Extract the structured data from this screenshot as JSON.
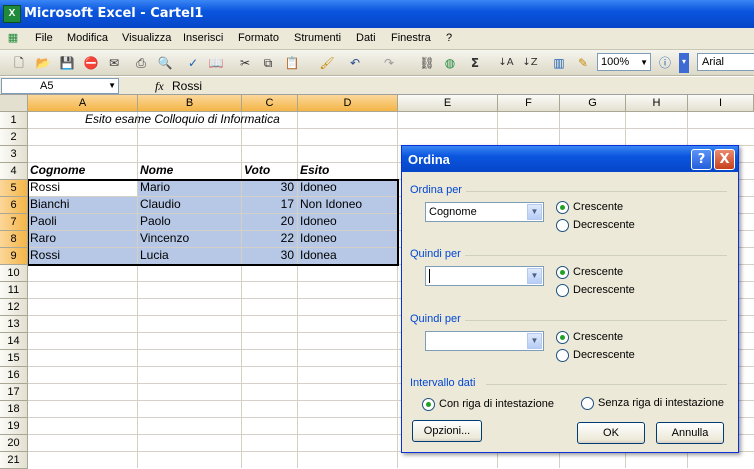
{
  "window": {
    "title": "Microsoft Excel - Cartel1",
    "app_icon": "X"
  },
  "menu": [
    "File",
    "Modifica",
    "Visualizza",
    "Inserisci",
    "Formato",
    "Strumenti",
    "Dati",
    "Finestra",
    "?"
  ],
  "toolbar": {
    "zoom": "100%",
    "font": "Arial",
    "sum_symbol": "Σ"
  },
  "formula_bar": {
    "cell_ref": "A5",
    "fx": "fx",
    "value": "Rossi"
  },
  "columns": [
    "A",
    "B",
    "C",
    "D",
    "E",
    "F",
    "G",
    "H",
    "I"
  ],
  "rows": [
    "1",
    "2",
    "3",
    "4",
    "5",
    "6",
    "7",
    "8",
    "9",
    "10",
    "11",
    "12",
    "13",
    "14",
    "15",
    "16",
    "17",
    "18",
    "19",
    "20",
    "21"
  ],
  "sheet": {
    "title": "Esito esame Colloquio di Informatica",
    "headers": [
      "Cognome",
      "Nome",
      "Voto",
      "Esito"
    ],
    "data": [
      [
        "Rossi",
        "Mario",
        "30",
        "Idoneo"
      ],
      [
        "Bianchi",
        "Claudio",
        "17",
        "Non Idoneo"
      ],
      [
        "Paoli",
        "Paolo",
        "20",
        "Idoneo"
      ],
      [
        "Raro",
        "Vincenzo",
        "22",
        "Idoneo"
      ],
      [
        "Rossi",
        "Lucia",
        "30",
        "Idonea"
      ]
    ]
  },
  "dialog": {
    "title": "Ordina",
    "help": "?",
    "close": "X",
    "sort_by": {
      "label": "Ordina per",
      "value": "Cognome",
      "asc": "Crescente",
      "desc": "Decrescente"
    },
    "then_by_1": {
      "label": "Quindi per",
      "value": "",
      "asc": "Crescente",
      "desc": "Decrescente"
    },
    "then_by_2": {
      "label": "Quindi per",
      "value": "",
      "asc": "Crescente",
      "desc": "Decrescente"
    },
    "range": {
      "label": "Intervallo dati",
      "with_header": "Con riga di intestazione",
      "without_header": "Senza riga di intestazione"
    },
    "buttons": {
      "options": "Opzioni...",
      "ok": "OK",
      "cancel": "Annulla"
    }
  }
}
